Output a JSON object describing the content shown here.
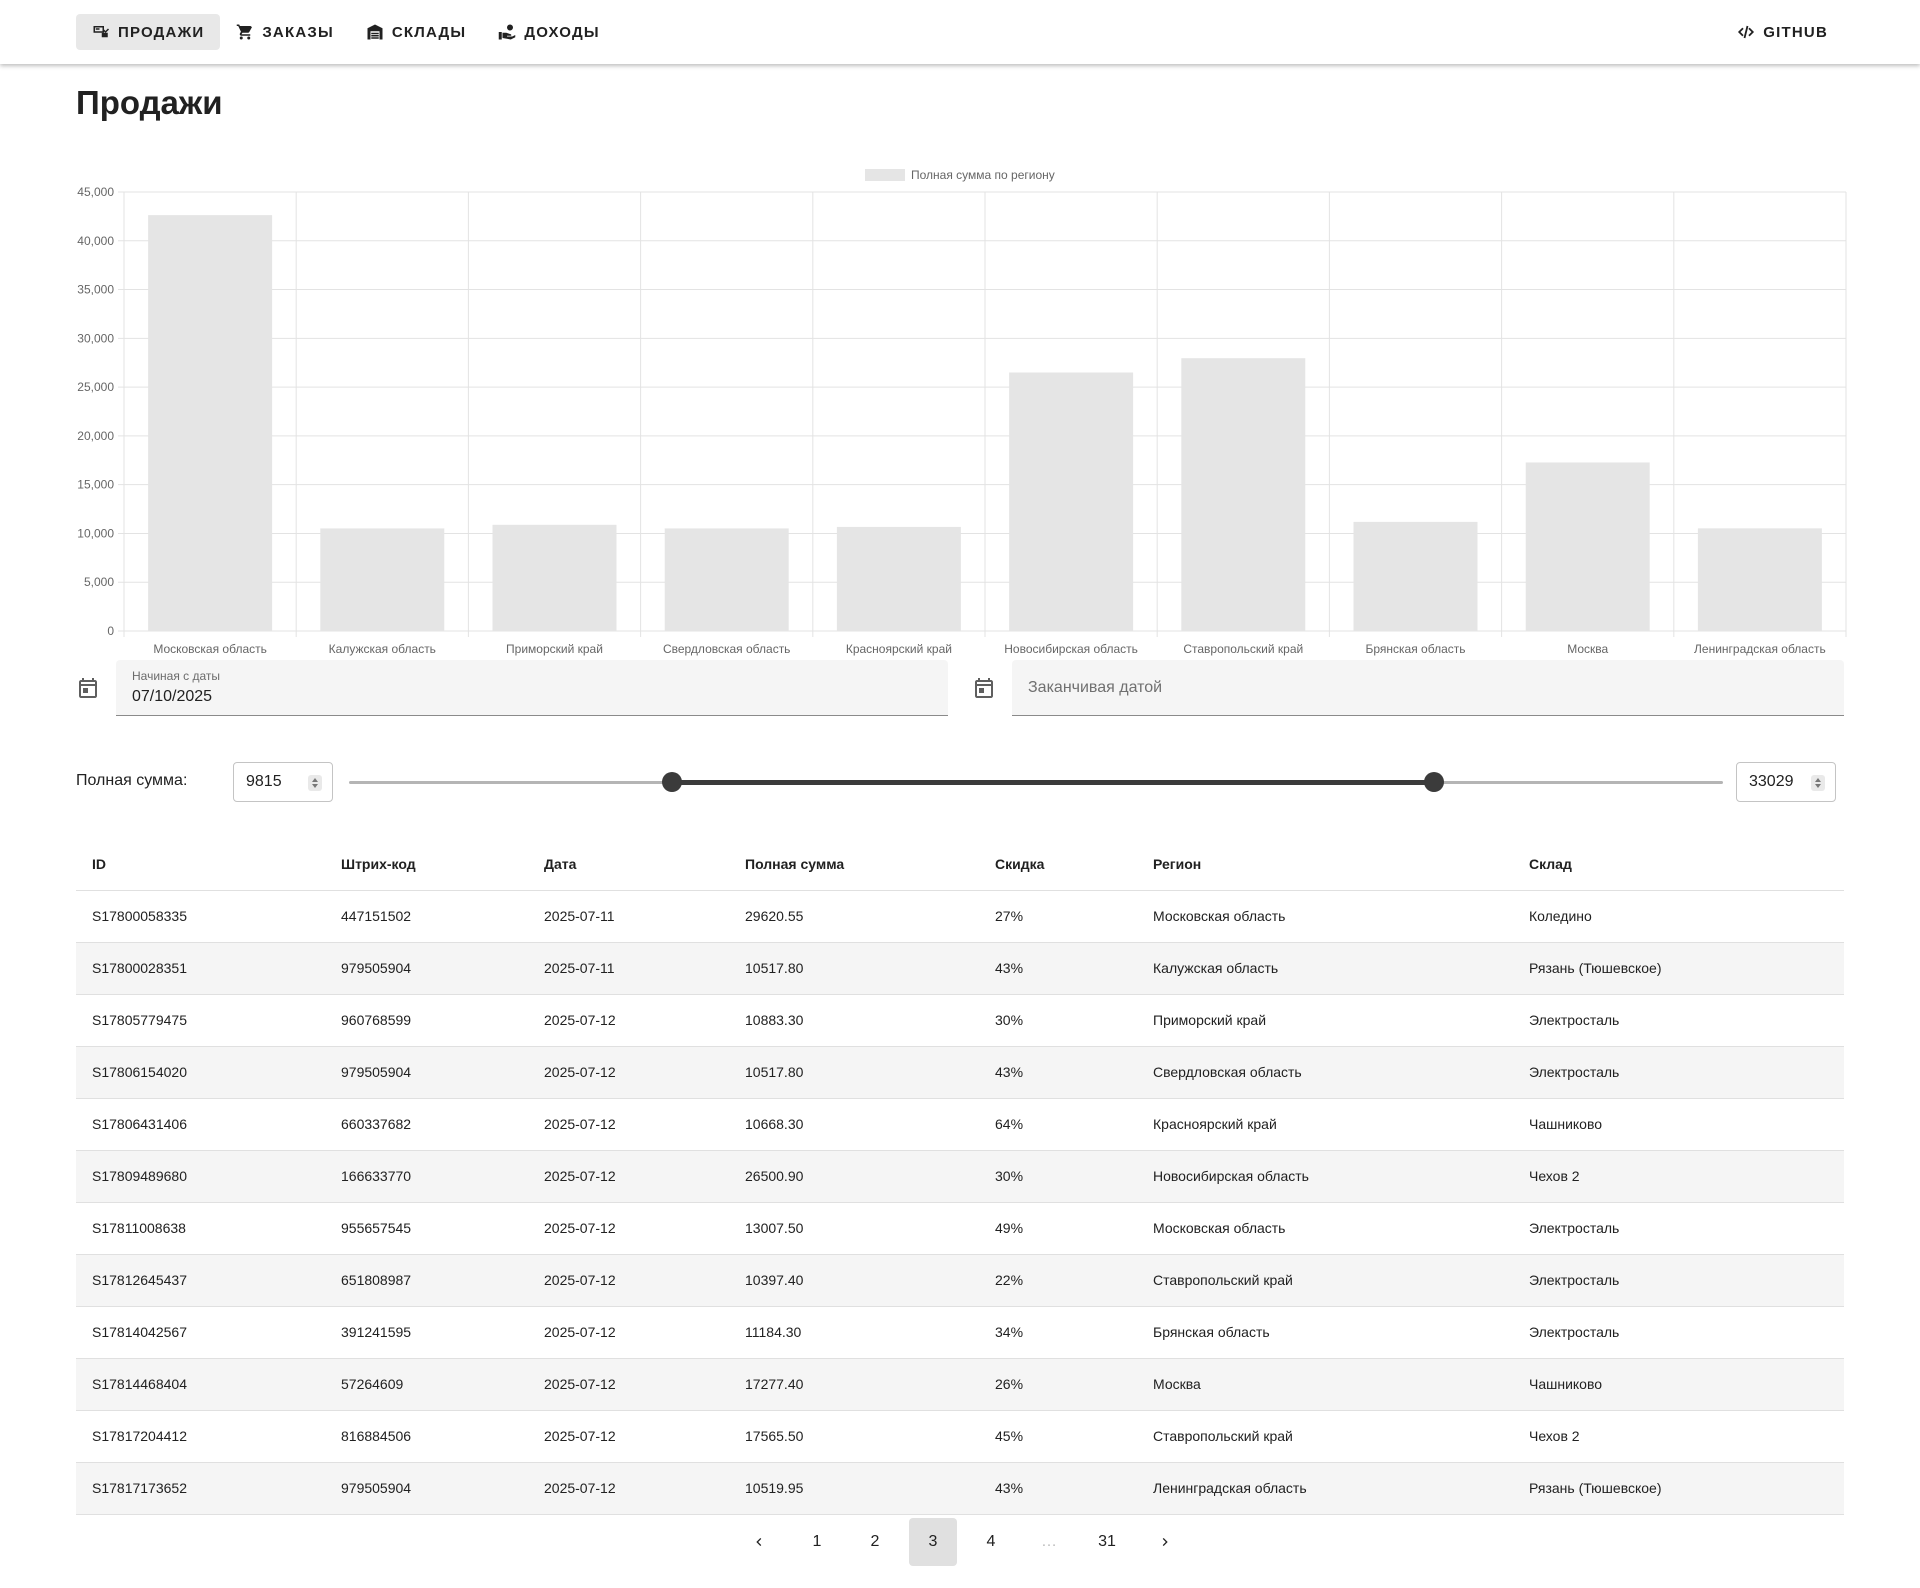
{
  "nav": {
    "tabs": [
      {
        "label": "Продажи",
        "icon": "point-of-sale-icon",
        "active": true
      },
      {
        "label": "Заказы",
        "icon": "cart-icon",
        "active": false
      },
      {
        "label": "Склады",
        "icon": "warehouse-icon",
        "active": false
      },
      {
        "label": "Доходы",
        "icon": "income-icon",
        "active": false
      }
    ],
    "github_label": "GitHub"
  },
  "page": {
    "title": "Продажи"
  },
  "chart_data": {
    "type": "bar",
    "legend": "Полная сумма по региону",
    "legend_position": "top",
    "categories": [
      "Московская область",
      "Калужская область",
      "Приморский край",
      "Свердловская область",
      "Красноярский край",
      "Новосибирская область",
      "Ставропольский край",
      "Брянская область",
      "Москва",
      "Ленинградская область"
    ],
    "series": [
      {
        "name": "Полная сумма по региону",
        "values": [
          42628.05,
          10517.8,
          10883.3,
          10517.8,
          10668.3,
          26500.9,
          27962.9,
          11184.3,
          17277.4,
          10519.95
        ]
      }
    ],
    "ylim": [
      0,
      45000
    ],
    "yticks": [
      "0",
      "5,000",
      "10,000",
      "15,000",
      "20,000",
      "25,000",
      "30,000",
      "35,000",
      "40,000",
      "45,000"
    ],
    "grid": true,
    "bar_color": "#e5e5e5"
  },
  "filters": {
    "start_date": {
      "label": "Начиная с даты",
      "value": "07/10/2025"
    },
    "end_date": {
      "placeholder": "Заканчивая датой"
    },
    "sum": {
      "label": "Полная сумма:",
      "min": 9815,
      "max": 33029,
      "scale_min": 0,
      "scale_max": 41812
    }
  },
  "table": {
    "columns": [
      "ID",
      "Штрих-код",
      "Дата",
      "Полная сумма",
      "Скидка",
      "Регион",
      "Склад"
    ],
    "rows": [
      [
        "S17800058335",
        "447151502",
        "2025-07-11",
        "29620.55",
        "27%",
        "Московская область",
        "Коледино"
      ],
      [
        "S17800028351",
        "979505904",
        "2025-07-11",
        "10517.80",
        "43%",
        "Калужская область",
        "Рязань (Тюшевское)"
      ],
      [
        "S17805779475",
        "960768599",
        "2025-07-12",
        "10883.30",
        "30%",
        "Приморский край",
        "Электросталь"
      ],
      [
        "S17806154020",
        "979505904",
        "2025-07-12",
        "10517.80",
        "43%",
        "Свердловская область",
        "Электросталь"
      ],
      [
        "S17806431406",
        "660337682",
        "2025-07-12",
        "10668.30",
        "64%",
        "Красноярский край",
        "Чашниково"
      ],
      [
        "S17809489680",
        "166633770",
        "2025-07-12",
        "26500.90",
        "30%",
        "Новосибирская область",
        "Чехов 2"
      ],
      [
        "S17811008638",
        "955657545",
        "2025-07-12",
        "13007.50",
        "49%",
        "Московская область",
        "Электросталь"
      ],
      [
        "S17812645437",
        "651808987",
        "2025-07-12",
        "10397.40",
        "22%",
        "Ставропольский край",
        "Электросталь"
      ],
      [
        "S17814042567",
        "391241595",
        "2025-07-12",
        "11184.30",
        "34%",
        "Брянская область",
        "Электросталь"
      ],
      [
        "S17814468404",
        "57264609",
        "2025-07-12",
        "17277.40",
        "26%",
        "Москва",
        "Чашниково"
      ],
      [
        "S17817204412",
        "816884506",
        "2025-07-12",
        "17565.50",
        "45%",
        "Ставропольский край",
        "Чехов 2"
      ],
      [
        "S17817173652",
        "979505904",
        "2025-07-12",
        "10519.95",
        "43%",
        "Ленинградская область",
        "Рязань (Тюшевское)"
      ]
    ]
  },
  "pagination": {
    "pages": [
      "1",
      "2",
      "3",
      "4",
      "…",
      "31"
    ],
    "current": "3",
    "prev_icon": "chevron-left-icon",
    "next_icon": "chevron-right-icon"
  }
}
